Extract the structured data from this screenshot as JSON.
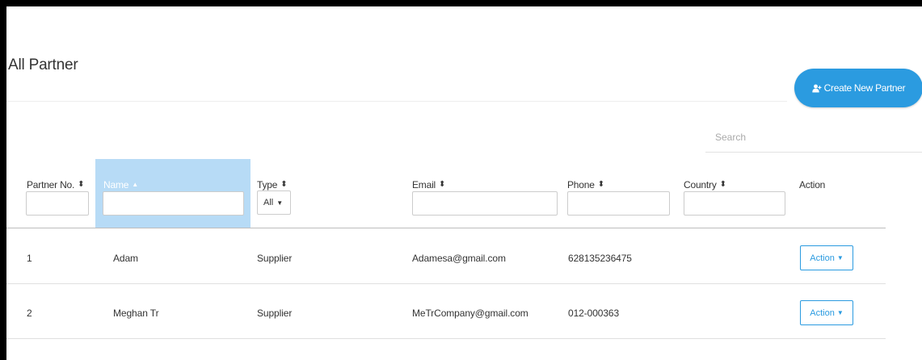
{
  "header": {
    "title": "All Partner",
    "create_button_label": "Create New Partner",
    "create_button_icon": "add-user-icon"
  },
  "search": {
    "placeholder": "Search",
    "value": ""
  },
  "table": {
    "columns": [
      {
        "label": "Partner No.",
        "sort": "none"
      },
      {
        "label": "Name",
        "sort": "asc"
      },
      {
        "label": "Type",
        "sort": "none"
      },
      {
        "label": "Email",
        "sort": "none"
      },
      {
        "label": "Phone",
        "sort": "none"
      },
      {
        "label": "Country",
        "sort": "none"
      },
      {
        "label": "Action",
        "sort": "none"
      }
    ],
    "filters": {
      "partner_no": "",
      "name": "",
      "type_selected": "All",
      "email": "",
      "phone": "",
      "country": ""
    },
    "rows": [
      {
        "no": "1",
        "name": "Adam",
        "type": "Supplier",
        "email": "Adamesa@gmail.com",
        "phone": "628135236475",
        "country": "",
        "action": "Action"
      },
      {
        "no": "2",
        "name": "Meghan Tr",
        "type": "Supplier",
        "email": "MeTrCompany@gmail.com",
        "phone": "012-000363",
        "country": "",
        "action": "Action"
      }
    ]
  },
  "colors": {
    "accent": "#2b9be0",
    "active_column": "#b7dbf6",
    "frame": "#000000"
  }
}
